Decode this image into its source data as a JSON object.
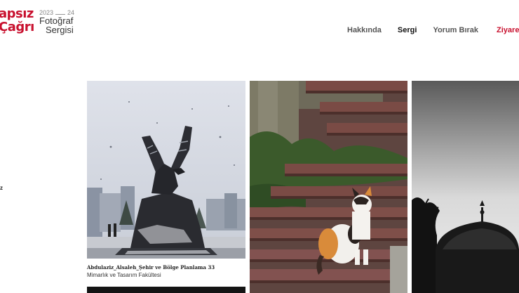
{
  "brand": {
    "line1": "apsız",
    "line2": "Çağrı",
    "year_start": "2023",
    "year_end": "24",
    "subtitle1": "Fotoğraf",
    "subtitle2": "Sergisi",
    "accent_color": "#c8102e"
  },
  "nav": {
    "items": [
      {
        "label": "Hakkında"
      },
      {
        "label": "Sergi"
      },
      {
        "label": "Yorum Bırak"
      },
      {
        "label": "Ziyaret"
      }
    ]
  },
  "side_fragment": "z",
  "gallery": {
    "items": [
      {
        "title": "Abdulaziz_Alsaleh_Şehir ve Bölge Planlama 33",
        "subtitle": "Mimarlık ve Tasarım Fakültesi"
      }
    ]
  }
}
